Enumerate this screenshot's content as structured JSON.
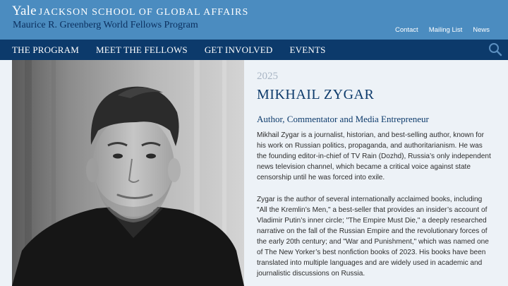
{
  "header": {
    "yale": "Yale",
    "school": "JACKSON SCHOOL OF GLOBAL AFFAIRS",
    "program": "Maurice R. Greenberg World Fellows Program",
    "links": [
      "Contact",
      "Mailing List",
      "News"
    ]
  },
  "nav": {
    "items": [
      "THE PROGRAM",
      "MEET THE FELLOWS",
      "GET INVOLVED",
      "EVENTS"
    ],
    "search_icon": "search-icon"
  },
  "profile": {
    "year": "2025",
    "name": "MIKHAIL ZYGAR",
    "role": "Author, Commentator and Media Entrepreneur",
    "bio": [
      "Mikhail Zygar is a journalist, historian, and best-selling author, known for his work on Russian politics, propaganda, and authoritarianism. He was the founding editor-in-chief of TV Rain (Dozhd), Russia’s only independent news television channel, which became a critical voice against state censorship until he was forced into exile.",
      "Zygar is the author of several internationally acclaimed books, including \"All the Kremlin’s Men,\" a best-seller that provides an insider’s account of Vladimir Putin’s inner circle; \"The Empire Must Die,\" a deeply researched narrative on the fall of the Russian Empire and the revolutionary forces of the early 20th century; and \"War and Punishment,\" which was named one of The New Yorker’s best nonfiction books of 2023. His books have been translated into multiple languages and are widely used in academic and journalistic discussions on Russia."
    ]
  },
  "colors": {
    "header_bg": "#4b8cc0",
    "nav_bg": "#0c3a6b",
    "content_bg": "#edf2f7",
    "title": "#0c3a6b"
  }
}
